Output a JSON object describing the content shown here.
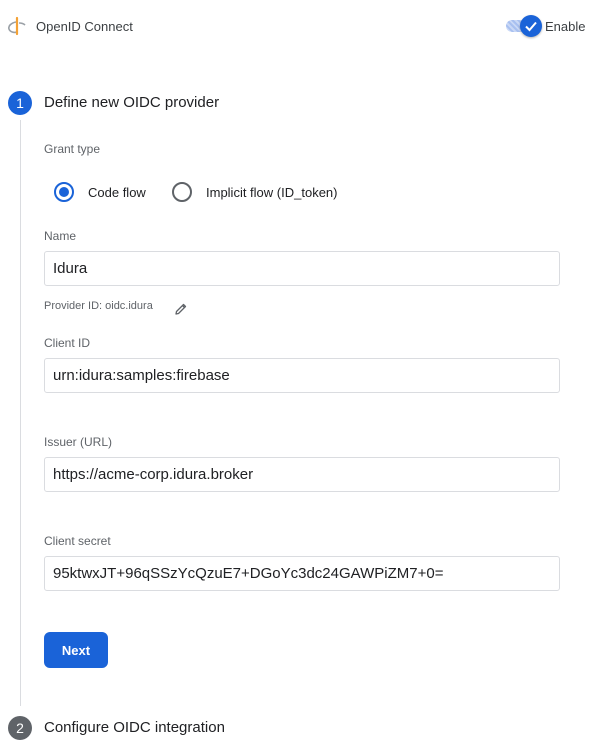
{
  "header": {
    "app_title": "OpenID Connect",
    "enable_label": "Enable",
    "enabled": true
  },
  "steps": [
    {
      "number": "1",
      "title": "Define new OIDC provider"
    },
    {
      "number": "2",
      "title": "Configure OIDC integration"
    }
  ],
  "form": {
    "grant_type_label": "Grant type",
    "grant_options": [
      {
        "label": "Code flow",
        "selected": true
      },
      {
        "label": "Implicit flow (ID_token)",
        "selected": false
      }
    ],
    "name_label": "Name",
    "name_value": "Idura",
    "provider_id_text": "Provider ID: oidc.idura",
    "client_id_label": "Client ID",
    "client_id_value": "urn:idura:samples:firebase",
    "issuer_label": "Issuer (URL)",
    "issuer_value": "https://acme-corp.idura.broker",
    "client_secret_label": "Client secret",
    "client_secret_value": "95ktwxJT+96qSSzYcQzuE7+DGoYc3dc24GAWPiZM7+0=",
    "next_label": "Next"
  },
  "colors": {
    "accent": "#1a63d8",
    "inactive_step": "#5f6368",
    "logo_orange": "#f4a236"
  },
  "icons": {
    "logo": "openid-logo-icon",
    "toggle_check": "check-icon",
    "edit": "pencil-icon"
  }
}
